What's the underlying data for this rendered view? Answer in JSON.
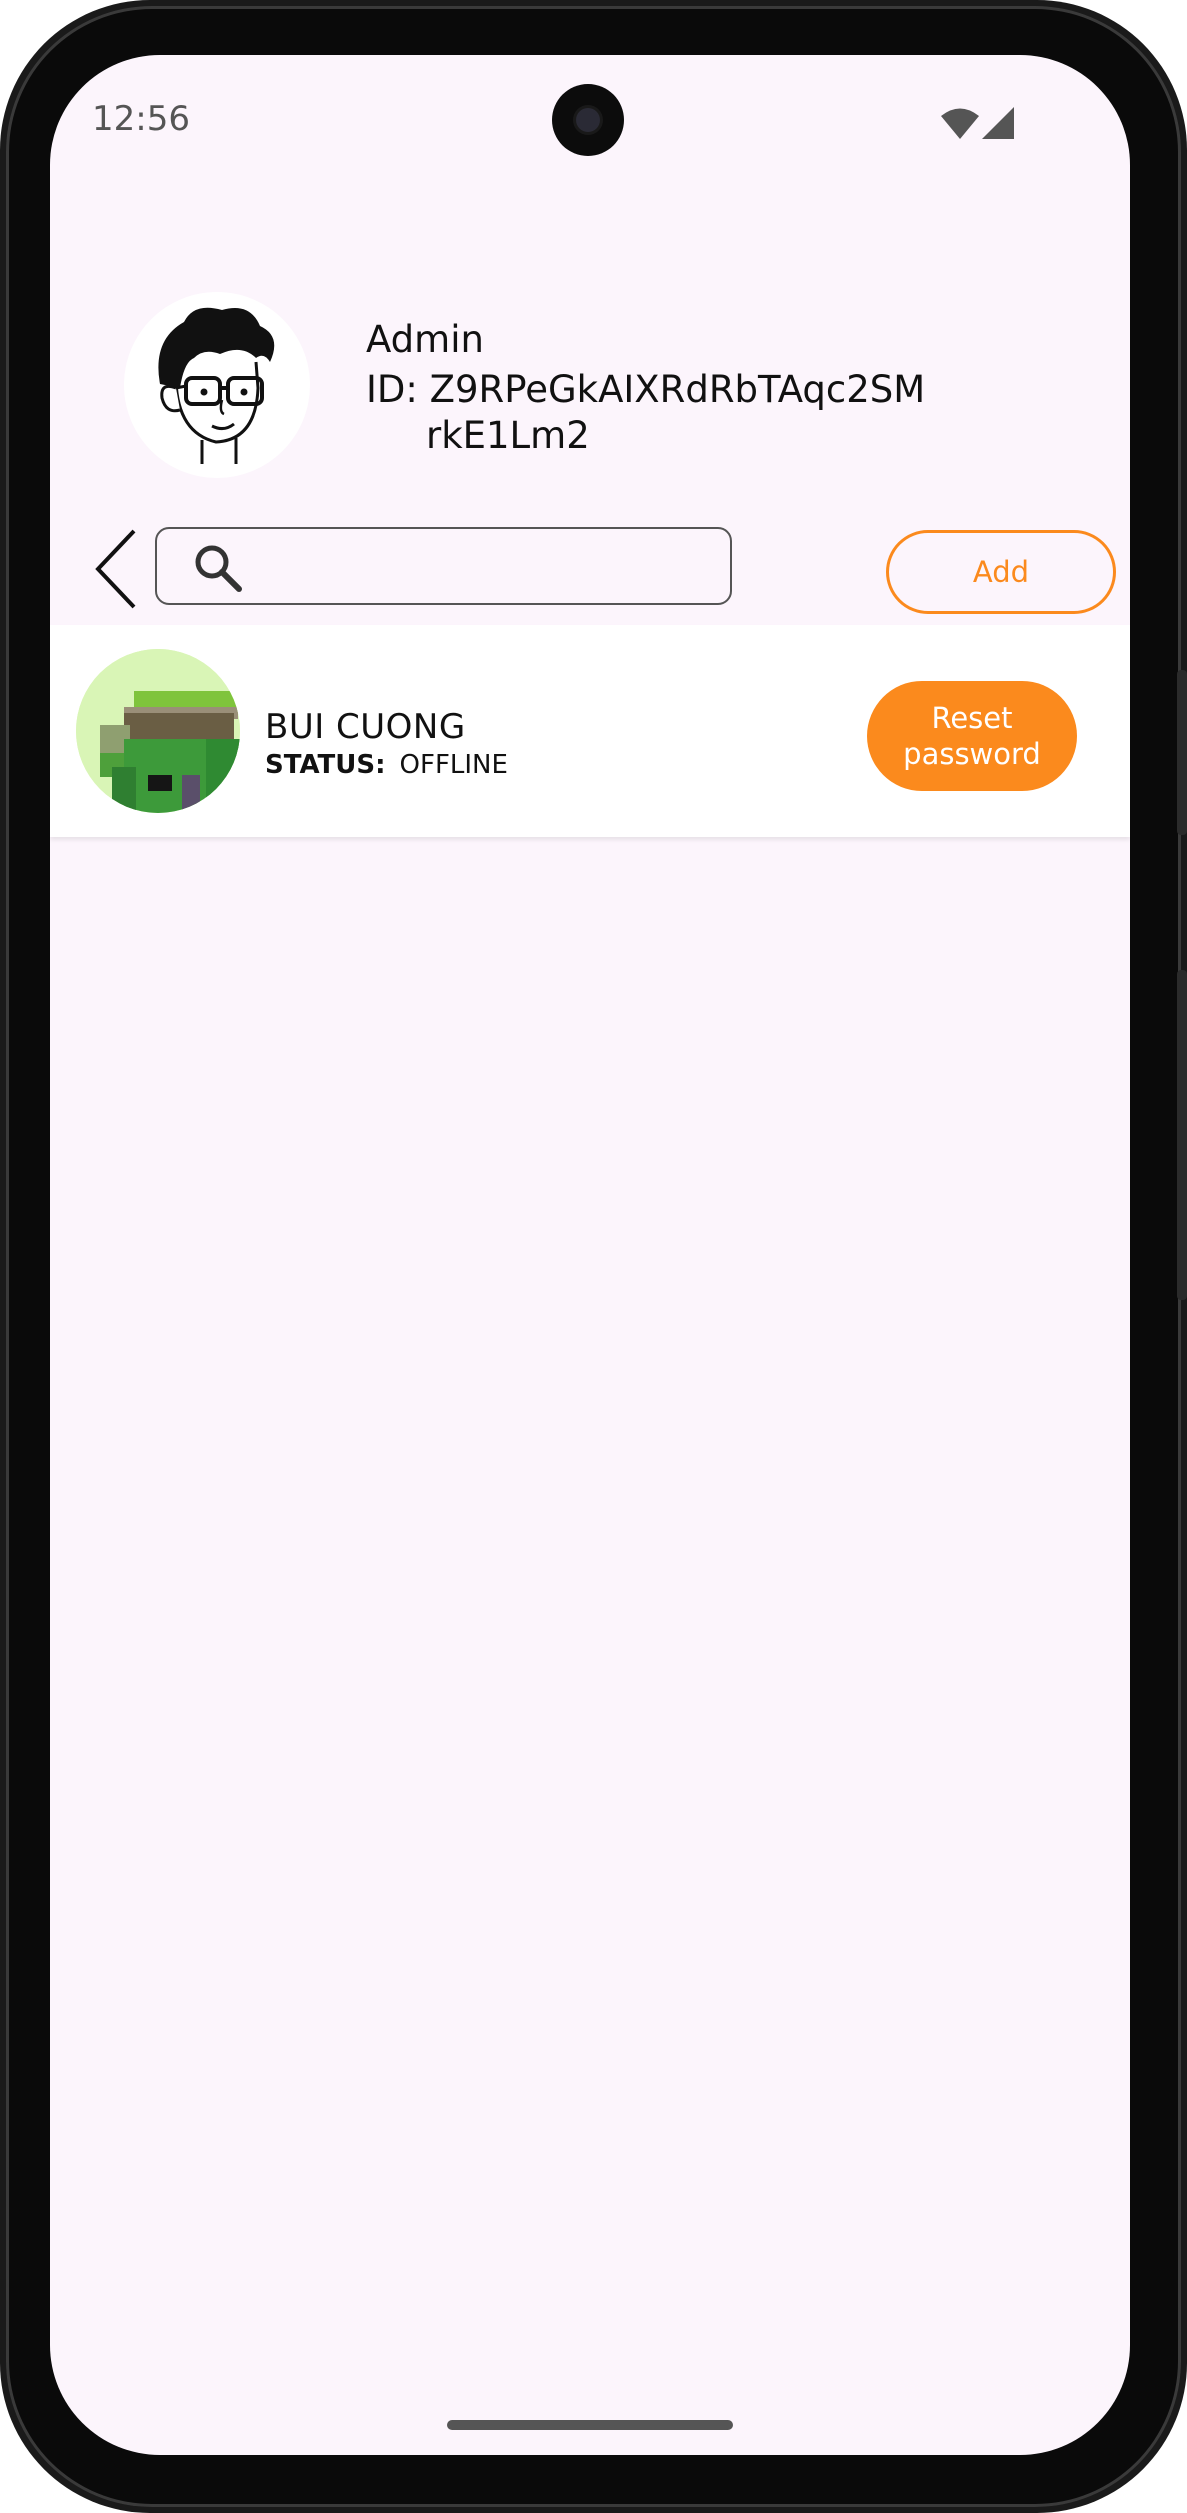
{
  "status_bar": {
    "time": "12:56",
    "wifi_icon": "wifi-icon",
    "signal_icon": "cell-signal-icon"
  },
  "header": {
    "name": "Admin",
    "id_line1": "ID: Z9RPeGkAIXRdRbTAqc2SM",
    "id_line2": "rkE1Lm2",
    "avatar_icon": "admin-avatar-illustration"
  },
  "toolbar": {
    "back_icon": "chevron-left-icon",
    "search_icon": "search-icon",
    "search_value": "",
    "add_label": "Add"
  },
  "users": [
    {
      "name": "BUI CUONG",
      "status_label": "STATUS:",
      "status_value": "OFFLINE",
      "reset_label": "Reset password"
    }
  ],
  "colors": {
    "accent": "#fb8a1d",
    "background": "#fcf5fc",
    "card": "#ffffff"
  }
}
